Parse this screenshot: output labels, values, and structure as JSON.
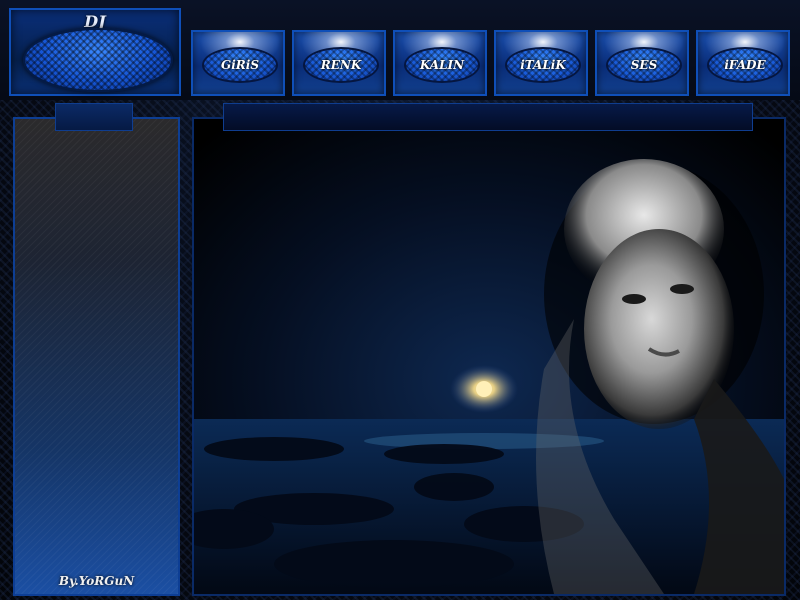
{
  "logo": {
    "title": "DJ"
  },
  "nav": [
    {
      "label": "GiRiS"
    },
    {
      "label": "RENK"
    },
    {
      "label": "KALIN"
    },
    {
      "label": "iTALiK"
    },
    {
      "label": "SES"
    },
    {
      "label": "iFADE"
    }
  ],
  "sidebar": {
    "signature": "By.YoRGuN"
  },
  "colors": {
    "accent": "#1656d6",
    "border": "#0f4fb8",
    "background": "#05080f"
  }
}
